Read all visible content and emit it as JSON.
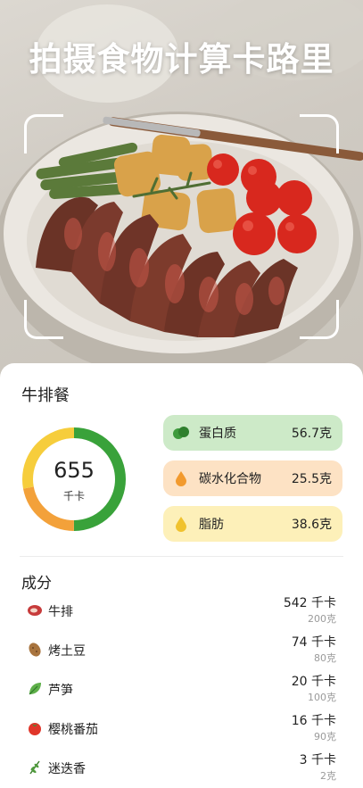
{
  "hero": {
    "title": "拍摄食物计算卡路里",
    "photo_subject": "steak-bowl-photo"
  },
  "meal": {
    "name": "牛排餐",
    "calories": "655",
    "calories_unit": "千卡"
  },
  "ring": {
    "segments": [
      {
        "name": "protein",
        "fraction": 0.5,
        "color": "#39a23a"
      },
      {
        "name": "carb",
        "fraction": 0.22,
        "color": "#f3a13a"
      },
      {
        "name": "fat",
        "fraction": 0.28,
        "color": "#f6cd3c"
      }
    ]
  },
  "macros": {
    "protein": {
      "label": "蛋白质",
      "value": "56.7克",
      "icon": "protein-icon",
      "color": "#cdeac8"
    },
    "carb": {
      "label": "碳水化合物",
      "value": "25.5克",
      "icon": "carb-drop-icon",
      "color": "#fde2c4"
    },
    "fat": {
      "label": "脂肪",
      "value": "38.6克",
      "icon": "fat-drop-icon",
      "color": "#fdf0b9"
    }
  },
  "ingredients_title": "成分",
  "ingredients": [
    {
      "name": "牛排",
      "kcal": "542 千卡",
      "grams": "200克",
      "icon": "meat-icon"
    },
    {
      "name": "烤土豆",
      "kcal": "74 千卡",
      "grams": "80克",
      "icon": "potato-icon"
    },
    {
      "name": "芦笋",
      "kcal": "20 千卡",
      "grams": "100克",
      "icon": "leafy-green-icon"
    },
    {
      "name": "樱桃番茄",
      "kcal": "16 千卡",
      "grams": "90克",
      "icon": "tomato-icon"
    },
    {
      "name": "迷迭香",
      "kcal": "3 千卡",
      "grams": "2克",
      "icon": "herb-icon"
    }
  ]
}
